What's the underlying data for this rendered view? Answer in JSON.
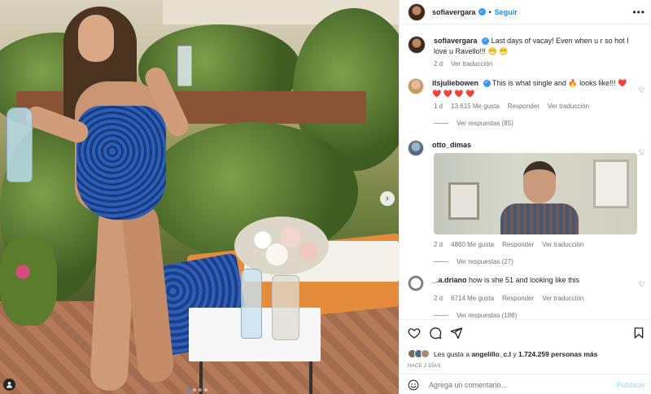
{
  "post": {
    "username": "sofiavergara",
    "follow_label": "Seguir",
    "more_label": "•••",
    "separator": "•"
  },
  "caption": {
    "username": "sofiavergara",
    "text": "Last days of vacay! Even when u r so hot I love u Ravello!!! 😁 😁",
    "time": "2 d",
    "translate": "Ver traducción"
  },
  "comments": [
    {
      "username": "itsjuliebowen",
      "text": "This is what single and 🔥 looks like!!!",
      "hearts": "❤️ ❤️ ❤️ ❤️ ❤️",
      "time": "1 d",
      "likes": "13.615 Me gusta",
      "reply": "Responder",
      "translate": "Ver traducción",
      "replies": "Ver respuestas (85)"
    },
    {
      "username": "otto_dimas",
      "time": "2 d",
      "likes": "4860 Me gusta",
      "reply": "Responder",
      "translate": "Ver traducción",
      "replies": "Ver respuestas (27)"
    },
    {
      "username": "_.a.driano",
      "text": "how is she 51 and looking like this",
      "time": "2 d",
      "likes": "6714 Me gusta",
      "reply": "Responder",
      "translate": "Ver traducción",
      "replies": "Ver respuestas (188)"
    }
  ],
  "likes": {
    "prefix": "Les gusta a",
    "user": "angelillo_c.l",
    "joiner": "y",
    "others": "1.724.259 personas más"
  },
  "date": "HACE 2 DÍAS",
  "add_comment": {
    "placeholder": "Agrega un comentario...",
    "publish": "Publicar"
  },
  "icons": {
    "like": "heart-icon",
    "comment": "comment-icon",
    "share": "share-icon",
    "save": "bookmark-icon",
    "emoji": "emoji-icon",
    "next": "chevron-right-icon",
    "tag": "user-tag-icon",
    "verified": "verified-badge-icon"
  },
  "colors": {
    "accent": "#0095f6",
    "verified": "#3897f0",
    "muted": "#737373",
    "publish_disabled": "#b2dffc"
  },
  "carousel": {
    "total": 4,
    "current": 1
  }
}
